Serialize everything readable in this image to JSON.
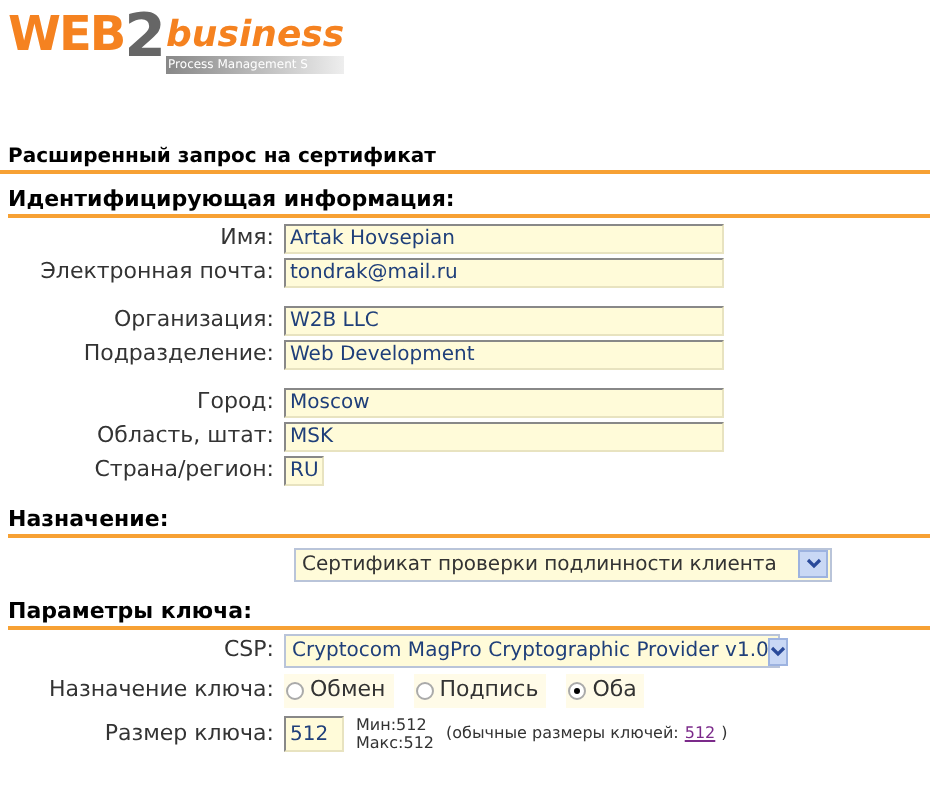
{
  "logo": {
    "word_1": "WEB",
    "word_2": "2",
    "word_3": "business",
    "tagline": "Process Management S"
  },
  "title": "Расширенный запрос на сертификат",
  "identity": {
    "heading": "Идентифицирующая информация:",
    "groups": [
      [
        {
          "label": "Имя:",
          "value": "Artak Hovsepian",
          "kind": "long"
        },
        {
          "label": "Электронная почта:",
          "value": "tondrak@mail.ru",
          "kind": "long"
        }
      ],
      [
        {
          "label": "Организация:",
          "value": "W2B LLC",
          "kind": "long"
        },
        {
          "label": "Подразделение:",
          "value": "Web Development",
          "kind": "long"
        }
      ],
      [
        {
          "label": "Город:",
          "value": "Moscow",
          "kind": "long"
        },
        {
          "label": "Область, штат:",
          "value": "MSK",
          "kind": "long"
        },
        {
          "label": "Страна/регион:",
          "value": "RU",
          "kind": "short"
        }
      ]
    ]
  },
  "purpose": {
    "heading": "Назначение:",
    "value": "Сертификат проверки подлинности клиента"
  },
  "key": {
    "heading": "Параметры ключа:",
    "csp_label": "CSP:",
    "csp_value": "Cryptocom MagPro Cryptographic Provider v1.0",
    "usage_label": "Назначение ключа:",
    "usage_options": [
      {
        "label": "Обмен",
        "selected": false
      },
      {
        "label": "Подпись",
        "selected": false
      },
      {
        "label": "Оба",
        "selected": true
      }
    ],
    "size_label": "Размер ключа:",
    "size_value": "512",
    "min": "Мин:512",
    "max": "Макс:512",
    "typical_prefix": "(обычные размеры ключей:",
    "typical_link": "512",
    "typical_suffix": ")"
  }
}
